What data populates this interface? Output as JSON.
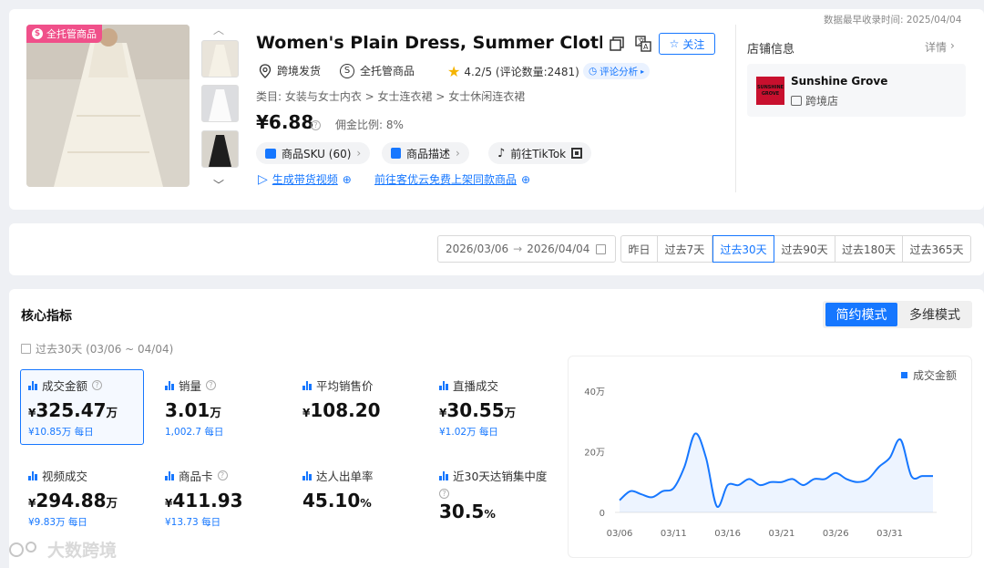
{
  "header": {
    "record_time_label": "数据最早收录时间: 2025/04/04"
  },
  "product": {
    "badge": "全托管商品",
    "title": "Women's Plain Dress, Summer Clothes",
    "follow_label": "关注",
    "shipping": "跨境发货",
    "managed": "全托管商品",
    "rating": "4.2/5 (评论数量:2481)",
    "review_analysis": "评论分析",
    "category": "类目: 女装与女士内衣 > 女士连衣裙 > 女士休闲连衣裙",
    "price": "¥6.88",
    "commission": "佣金比例: 8%",
    "sku_label": "商品SKU (60)",
    "desc_label": "商品描述",
    "tiktok_label": "前往TikTok",
    "video_link": "生成带货视频",
    "kyy_link": "前往客优云免费上架同款商品"
  },
  "shop": {
    "section_title": "店铺信息",
    "details_label": "详情",
    "name": "Sunshine Grove",
    "type": "跨境店",
    "logo_text": "SUNSHINE GROVE"
  },
  "date_range": {
    "start": "2026/03/06",
    "end": "2026/04/04",
    "arrow": "→",
    "options": [
      "昨日",
      "过去7天",
      "过去30天",
      "过去90天",
      "过去180天",
      "过去365天"
    ],
    "selected": "过去30天"
  },
  "core": {
    "title": "核心指标",
    "mode_simple": "简约模式",
    "mode_multi": "多维模式",
    "period": "过去30天 (03/06 ~ 04/04)",
    "metrics": [
      {
        "title": "成交金额",
        "cur": "¥",
        "value": "325.47",
        "unit": "万",
        "sub": "¥10.85万 每日",
        "help": true
      },
      {
        "title": "销量",
        "cur": "",
        "value": "3.01",
        "unit": "万",
        "sub": "1,002.7 每日",
        "help": true
      },
      {
        "title": "平均销售价",
        "cur": "¥",
        "value": "108.20",
        "unit": "",
        "sub": "",
        "help": false
      },
      {
        "title": "直播成交",
        "cur": "¥",
        "value": "30.55",
        "unit": "万",
        "sub": "¥1.02万 每日",
        "help": false
      },
      {
        "title": "视频成交",
        "cur": "¥",
        "value": "294.88",
        "unit": "万",
        "sub": "¥9.83万 每日",
        "help": false
      },
      {
        "title": "商品卡",
        "cur": "¥",
        "value": "411.93",
        "unit": "",
        "sub": "¥13.73 每日",
        "help": true
      },
      {
        "title": "达人出单率",
        "cur": "",
        "value": "45.10",
        "unit": "%",
        "sub": "",
        "help": false
      },
      {
        "title": "近30天达销集中度",
        "cur": "",
        "value": "30.5",
        "unit": "%",
        "sub": "",
        "help": true
      }
    ]
  },
  "watermark": "大数跨境",
  "colors": {
    "accent": "#1677ff",
    "badge": "#f0508a",
    "logo_bg": "#c8102e"
  },
  "chart_data": {
    "type": "area",
    "legend": [
      "成交金额"
    ],
    "legend_position": "top-right",
    "yticks": [
      "40万",
      "20万",
      "0"
    ],
    "ylim": [
      0,
      40
    ],
    "xticks": [
      "03/06",
      "03/11",
      "03/16",
      "03/21",
      "03/26",
      "03/31"
    ],
    "series": [
      {
        "name": "成交金额",
        "unit": "万",
        "x": [
          "03/06",
          "03/07",
          "03/08",
          "03/09",
          "03/10",
          "03/11",
          "03/12",
          "03/13",
          "03/14",
          "03/15",
          "03/16",
          "03/17",
          "03/18",
          "03/19",
          "03/20",
          "03/21",
          "03/22",
          "03/23",
          "03/24",
          "03/25",
          "03/26",
          "03/27",
          "03/28",
          "03/29",
          "03/30",
          "03/31",
          "04/01",
          "04/02",
          "04/03",
          "04/04"
        ],
        "values": [
          4,
          7,
          6,
          5,
          7,
          8,
          15,
          26,
          18,
          2,
          9,
          9,
          11,
          9,
          10,
          10,
          11,
          9,
          11,
          11,
          13,
          11,
          10,
          11,
          15,
          18,
          24,
          12,
          12,
          12
        ]
      }
    ]
  }
}
